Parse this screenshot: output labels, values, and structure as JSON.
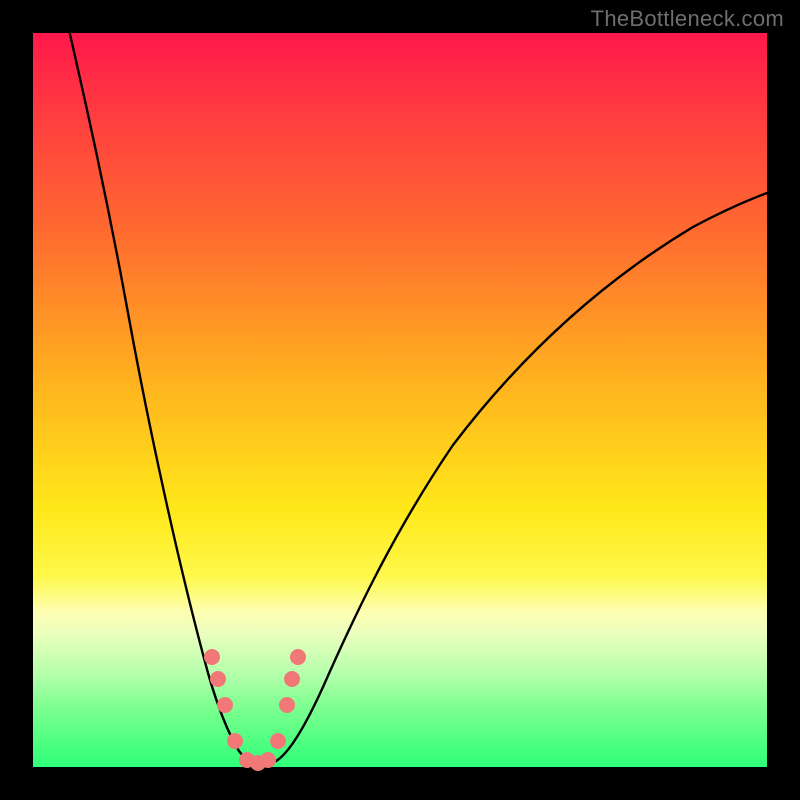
{
  "watermark": "TheBottleneck.com",
  "chart_data": {
    "type": "line",
    "title": "",
    "xlabel": "",
    "ylabel": "",
    "xlim": [
      0,
      100
    ],
    "ylim": [
      0,
      100
    ],
    "grid": false,
    "legend": false,
    "background_gradient": {
      "top": "#ff184a",
      "bottom": "#2fff78"
    },
    "series": [
      {
        "name": "bottleneck-curve",
        "color": "#000000",
        "x": [
          5,
          8,
          12,
          16,
          20,
          24,
          26,
          28,
          29,
          30,
          31,
          32,
          34,
          36,
          40,
          48,
          56,
          66,
          78,
          90,
          100
        ],
        "y": [
          100,
          86,
          70,
          53,
          36,
          18,
          9,
          3,
          1,
          0,
          0,
          0,
          2,
          6,
          16,
          32,
          44,
          55,
          65,
          73,
          78
        ]
      }
    ],
    "highlight_points": {
      "color": "#f27878",
      "x": [
        24.5,
        25.3,
        26.2,
        27.6,
        29.2,
        30.6,
        32.0,
        33.4,
        34.6,
        35.3,
        36.1
      ],
      "y": [
        15,
        12,
        8.5,
        3.5,
        1,
        0.5,
        1,
        3.5,
        8.5,
        12,
        15
      ]
    }
  }
}
